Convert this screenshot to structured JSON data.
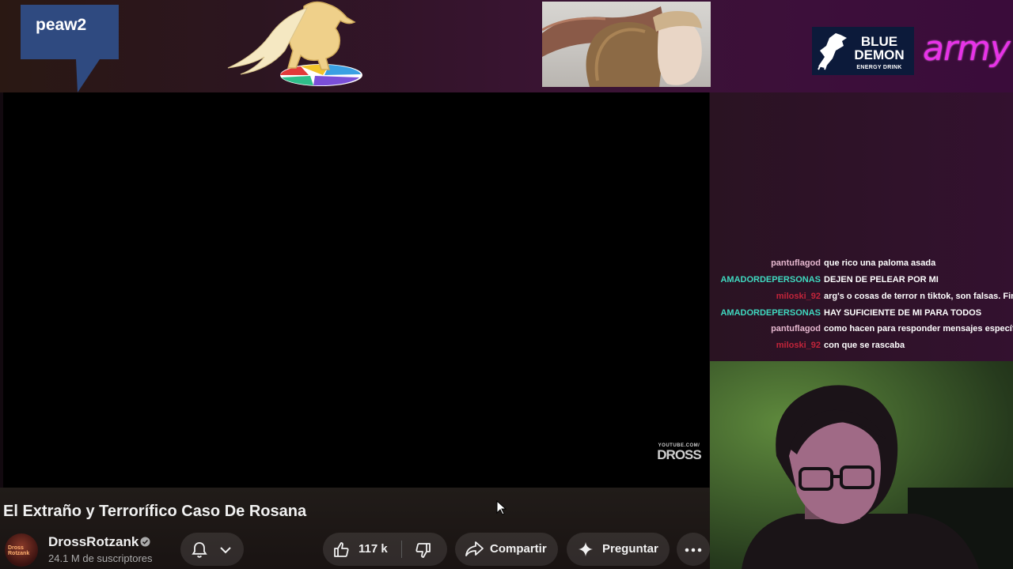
{
  "banner": {
    "speech_bubble_text": "peaw2",
    "sponsor": {
      "name": "BLUE DEMON",
      "sub": "ENERGY DRINK"
    },
    "army_text": "army"
  },
  "video": {
    "watermark_top": "YOUTUBE.COM/",
    "watermark_main": "DROSS",
    "title": "El Extraño y Terrorífico Caso De Rosana"
  },
  "channel": {
    "avatar_text": "Dross Rotzank",
    "name": "DrossRotzank",
    "subscribers": "24.1 M de suscriptores"
  },
  "actions": {
    "likes": "117 k",
    "share": "Compartir",
    "ask": "Preguntar"
  },
  "chat": {
    "messages": [
      {
        "user": "pantuflagod",
        "user_color": "#e6b8cf",
        "text": "que rico una paloma asada"
      },
      {
        "user": "AMADORDEPERSONAS",
        "user_color": "#3fd9c0",
        "text": "DEJEN DE PELEAR POR MI"
      },
      {
        "user": "miloski_92",
        "user_color": "#c2243a",
        "text": "arg's o cosas de terror n tiktok, son falsas. Fin."
      },
      {
        "user": "AMADORDEPERSONAS",
        "user_color": "#3fd9c0",
        "text": "HAY SUFICIENTE DE MI PARA TODOS"
      },
      {
        "user": "pantuflagod",
        "user_color": "#e6b8cf",
        "text": "como hacen para responder mensajes específicos"
      },
      {
        "user": "miloski_92",
        "user_color": "#c2243a",
        "text": "con que se rascaba"
      }
    ]
  },
  "colors": {
    "speech_bubble": "#2f4a80",
    "army": "#e832e8",
    "sponsor_bg": "#0c1a3a"
  }
}
